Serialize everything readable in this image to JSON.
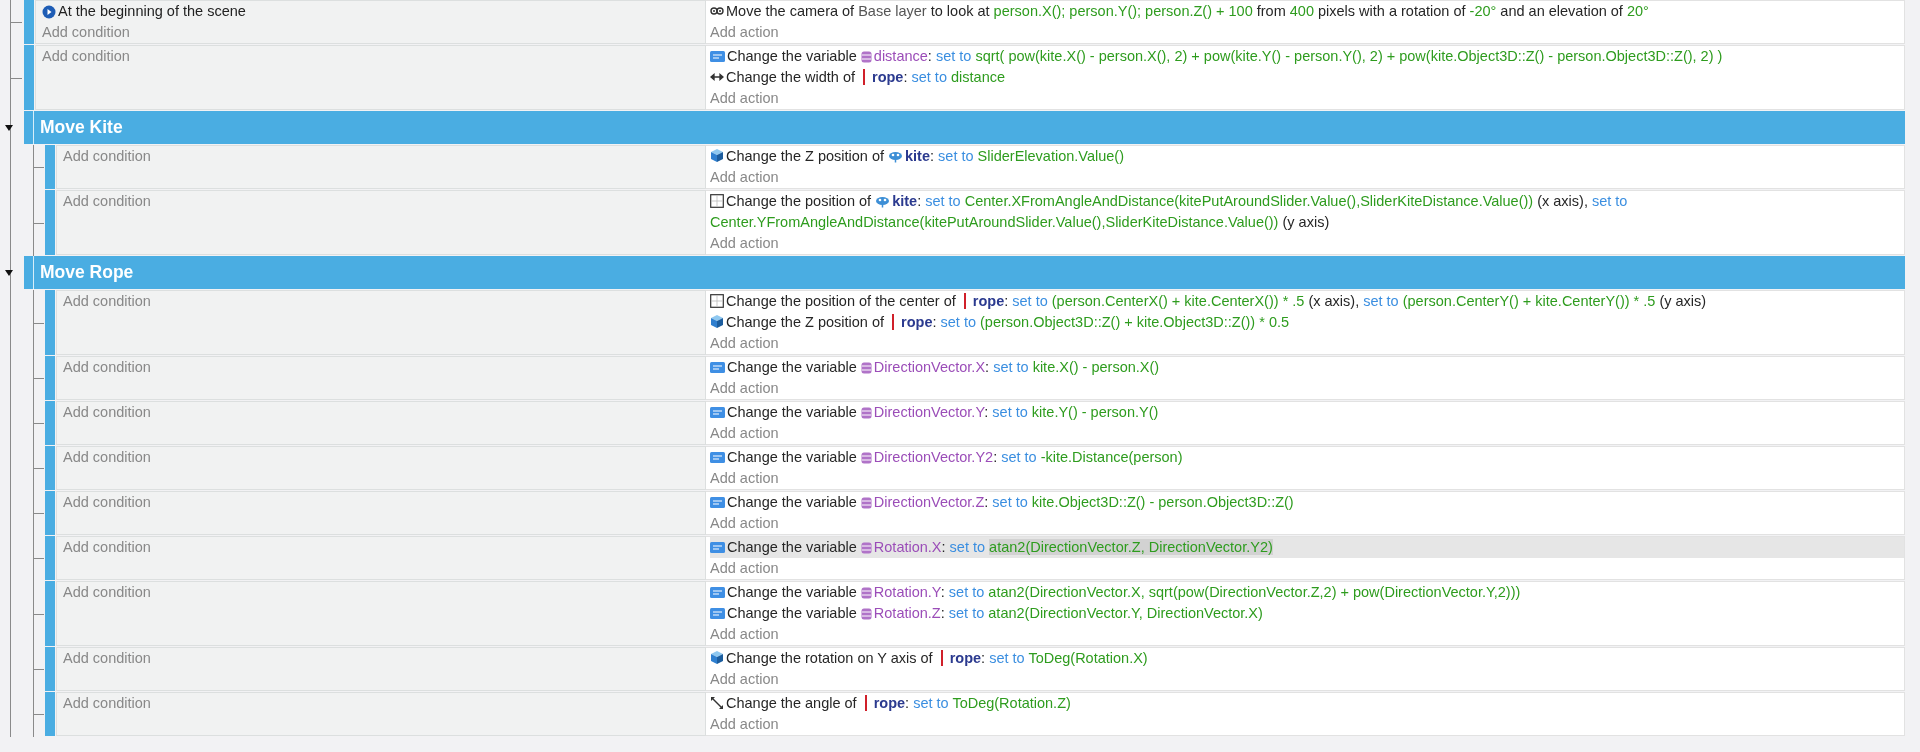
{
  "events": [
    {
      "kind": "standard",
      "conditions": [
        {
          "kind": "start",
          "text": "At the beginning of the scene"
        }
      ],
      "add_condition": "Add condition",
      "add_action": "Add action",
      "actions": [
        {
          "kind": "camera",
          "selected": false,
          "parts": [
            {
              "kind": "text",
              "text": "Move the camera of"
            },
            {
              "kind": "layer",
              "text": "Base layer"
            },
            {
              "kind": "text",
              "text": "to look at"
            },
            {
              "kind": "expr",
              "text": "person.X(); person.Y(); person.Z() + 100"
            },
            {
              "kind": "text",
              "text": "from"
            },
            {
              "kind": "expr",
              "text": "400"
            },
            {
              "kind": "text",
              "text": "pixels with a rotation of"
            },
            {
              "kind": "expr",
              "text": "-20°"
            },
            {
              "kind": "text",
              "text": "and an elevation of"
            },
            {
              "kind": "expr",
              "text": "20°"
            }
          ]
        }
      ]
    },
    {
      "kind": "standard",
      "add_condition": "Add condition",
      "add_action": "Add action",
      "actions": [
        {
          "kind": "variable",
          "selected": false,
          "parts": [
            {
              "kind": "text",
              "text": "Change the variable"
            },
            {
              "kind": "var",
              "text": "distance"
            },
            {
              "kind": "punct",
              "text": ":"
            },
            {
              "kind": "kw",
              "text": "set to"
            },
            {
              "kind": "expr",
              "text": "sqrt( pow(kite.X() - person.X(), 2) + pow(kite.Y() - person.Y(), 2) + pow(kite.Object3D::Z() - person.Object3D::Z(), 2) )"
            }
          ]
        },
        {
          "kind": "width",
          "selected": false,
          "parts": [
            {
              "kind": "text",
              "text": "Change the width of"
            },
            {
              "kind": "line_object",
              "text": "rope"
            },
            {
              "kind": "punct",
              "text": ":"
            },
            {
              "kind": "kw",
              "text": "set to"
            },
            {
              "kind": "expr",
              "text": "distance"
            }
          ]
        }
      ]
    },
    {
      "kind": "group",
      "title": "Move Kite",
      "expanded": true,
      "children": [
        {
          "kind": "standard",
          "add_condition": "Add condition",
          "add_action": "Add action",
          "actions": [
            {
              "kind": "cube",
              "selected": false,
              "parts": [
                {
                  "kind": "text",
                  "text": "Change the Z position of"
                },
                {
                  "kind": "bird_object",
                  "text": "kite"
                },
                {
                  "kind": "punct",
                  "text": ":"
                },
                {
                  "kind": "kw",
                  "text": "set to"
                },
                {
                  "kind": "expr",
                  "text": "SliderElevation.Value()"
                }
              ]
            }
          ]
        },
        {
          "kind": "standard",
          "add_condition": "Add condition",
          "add_action": "Add action",
          "actions": [
            {
              "kind": "position",
              "selected": false,
              "parts": [
                {
                  "kind": "text",
                  "text": "Change the position of"
                },
                {
                  "kind": "bird_object",
                  "text": "kite"
                },
                {
                  "kind": "punct",
                  "text": ":"
                },
                {
                  "kind": "kw",
                  "text": "set to"
                },
                {
                  "kind": "expr",
                  "text": "Center.XFromAngleAndDistance(kitePutAroundSlider.Value(),SliderKiteDistance.Value())"
                },
                {
                  "kind": "text",
                  "text": "(x axis),"
                },
                {
                  "kind": "kw",
                  "text": "set to"
                },
                {
                  "kind": "expr",
                  "text": "Center.YFromAngleAndDistance(kitePutAroundSlider.Value(),SliderKiteDistance.Value())"
                },
                {
                  "kind": "text",
                  "text": "(y axis)"
                }
              ]
            }
          ]
        }
      ]
    },
    {
      "kind": "group",
      "title": "Move Rope",
      "expanded": true,
      "children": [
        {
          "kind": "standard",
          "add_condition": "Add condition",
          "add_action": "Add action",
          "actions": [
            {
              "kind": "position",
              "selected": false,
              "parts": [
                {
                  "kind": "text",
                  "text": "Change the position of the center of"
                },
                {
                  "kind": "line_object",
                  "text": "rope"
                },
                {
                  "kind": "punct",
                  "text": ":"
                },
                {
                  "kind": "kw",
                  "text": "set to"
                },
                {
                  "kind": "expr",
                  "text": "(person.CenterX() + kite.CenterX()) * .5"
                },
                {
                  "kind": "text",
                  "text": "(x axis),"
                },
                {
                  "kind": "kw",
                  "text": "set to"
                },
                {
                  "kind": "expr",
                  "text": "(person.CenterY() + kite.CenterY()) * .5"
                },
                {
                  "kind": "text",
                  "text": "(y axis)"
                }
              ]
            },
            {
              "kind": "cube",
              "selected": false,
              "parts": [
                {
                  "kind": "text",
                  "text": "Change the Z position of"
                },
                {
                  "kind": "line_object",
                  "text": "rope"
                },
                {
                  "kind": "punct",
                  "text": ":"
                },
                {
                  "kind": "kw",
                  "text": "set to"
                },
                {
                  "kind": "expr",
                  "text": "(person.Object3D::Z() + kite.Object3D::Z()) * 0.5"
                }
              ]
            }
          ]
        },
        {
          "kind": "standard",
          "add_condition": "Add condition",
          "add_action": "Add action",
          "actions": [
            {
              "kind": "variable",
              "selected": false,
              "parts": [
                {
                  "kind": "text",
                  "text": "Change the variable"
                },
                {
                  "kind": "var",
                  "text": "DirectionVector.X"
                },
                {
                  "kind": "punct",
                  "text": ":"
                },
                {
                  "kind": "kw",
                  "text": "set to"
                },
                {
                  "kind": "expr",
                  "text": "kite.X() - person.X()"
                }
              ]
            }
          ]
        },
        {
          "kind": "standard",
          "add_condition": "Add condition",
          "add_action": "Add action",
          "actions": [
            {
              "kind": "variable",
              "selected": false,
              "parts": [
                {
                  "kind": "text",
                  "text": "Change the variable"
                },
                {
                  "kind": "var",
                  "text": "DirectionVector.Y"
                },
                {
                  "kind": "punct",
                  "text": ":"
                },
                {
                  "kind": "kw",
                  "text": "set to"
                },
                {
                  "kind": "expr",
                  "text": "kite.Y() - person.Y()"
                }
              ]
            }
          ]
        },
        {
          "kind": "standard",
          "add_condition": "Add condition",
          "add_action": "Add action",
          "actions": [
            {
              "kind": "variable",
              "selected": false,
              "parts": [
                {
                  "kind": "text",
                  "text": "Change the variable"
                },
                {
                  "kind": "var",
                  "text": "DirectionVector.Y2"
                },
                {
                  "kind": "punct",
                  "text": ":"
                },
                {
                  "kind": "kw",
                  "text": "set to"
                },
                {
                  "kind": "expr",
                  "text": "-kite.Distance(person)"
                }
              ]
            }
          ]
        },
        {
          "kind": "standard",
          "add_condition": "Add condition",
          "add_action": "Add action",
          "actions": [
            {
              "kind": "variable",
              "selected": false,
              "parts": [
                {
                  "kind": "text",
                  "text": "Change the variable"
                },
                {
                  "kind": "var",
                  "text": "DirectionVector.Z"
                },
                {
                  "kind": "punct",
                  "text": ":"
                },
                {
                  "kind": "kw",
                  "text": "set to"
                },
                {
                  "kind": "expr",
                  "text": "kite.Object3D::Z() - person.Object3D::Z()"
                }
              ]
            }
          ]
        },
        {
          "kind": "standard",
          "add_condition": "Add condition",
          "add_action": "Add action",
          "actions": [
            {
              "kind": "variable",
              "selected": true,
              "parts": [
                {
                  "kind": "text",
                  "text": "Change the variable"
                },
                {
                  "kind": "var",
                  "text": "Rotation.X"
                },
                {
                  "kind": "punct",
                  "text": ":"
                },
                {
                  "kind": "kw",
                  "text": "set to"
                },
                {
                  "kind": "expr",
                  "text": "atan2(DirectionVector.Z, DirectionVector.Y2)"
                }
              ]
            }
          ]
        },
        {
          "kind": "standard",
          "add_condition": "Add condition",
          "add_action": "Add action",
          "actions": [
            {
              "kind": "variable",
              "selected": false,
              "parts": [
                {
                  "kind": "text",
                  "text": "Change the variable"
                },
                {
                  "kind": "var",
                  "text": "Rotation.Y"
                },
                {
                  "kind": "punct",
                  "text": ":"
                },
                {
                  "kind": "kw",
                  "text": "set to"
                },
                {
                  "kind": "expr",
                  "text": "atan2(DirectionVector.X, sqrt(pow(DirectionVector.Z,2) + pow(DirectionVector.Y,2)))"
                }
              ]
            },
            {
              "kind": "variable",
              "selected": false,
              "parts": [
                {
                  "kind": "text",
                  "text": "Change the variable"
                },
                {
                  "kind": "var",
                  "text": "Rotation.Z"
                },
                {
                  "kind": "punct",
                  "text": ":"
                },
                {
                  "kind": "kw",
                  "text": "set to"
                },
                {
                  "kind": "expr",
                  "text": "atan2(DirectionVector.Y, DirectionVector.X)"
                }
              ]
            }
          ]
        },
        {
          "kind": "standard",
          "add_condition": "Add condition",
          "add_action": "Add action",
          "actions": [
            {
              "kind": "cube",
              "selected": false,
              "parts": [
                {
                  "kind": "text",
                  "text": "Change the rotation on Y axis of"
                },
                {
                  "kind": "line_object",
                  "text": "rope"
                },
                {
                  "kind": "punct",
                  "text": ":"
                },
                {
                  "kind": "kw",
                  "text": "set to"
                },
                {
                  "kind": "expr",
                  "text": "ToDeg(Rotation.X)"
                }
              ]
            }
          ]
        },
        {
          "kind": "standard",
          "add_condition": "Add condition",
          "add_action": "Add action",
          "actions": [
            {
              "kind": "angle",
              "selected": false,
              "parts": [
                {
                  "kind": "text",
                  "text": "Change the angle of"
                },
                {
                  "kind": "line_object",
                  "text": "rope"
                },
                {
                  "kind": "punct",
                  "text": ":"
                },
                {
                  "kind": "kw",
                  "text": "set to"
                },
                {
                  "kind": "expr",
                  "text": "ToDeg(Rotation.Z)"
                }
              ]
            }
          ]
        }
      ]
    }
  ]
}
